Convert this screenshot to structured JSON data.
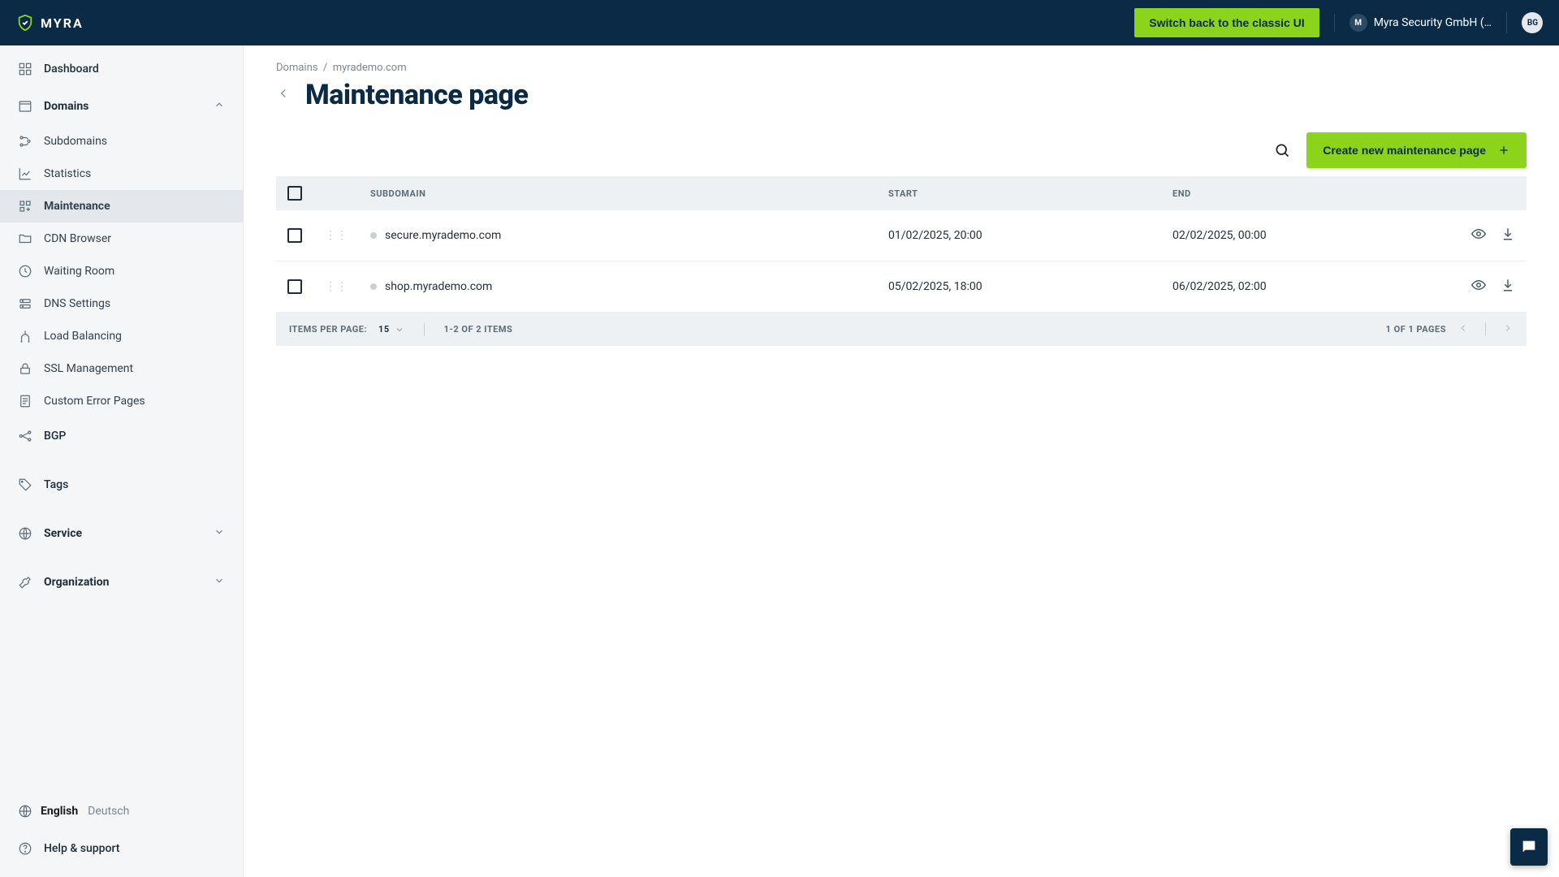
{
  "brand": "MYRA",
  "header": {
    "classic_ui_label": "Switch back to the classic UI",
    "org_name": "Myra Security GmbH (…",
    "org_initial": "M",
    "user_initials": "BG"
  },
  "sidebar": {
    "dashboard": "Dashboard",
    "domains": "Domains",
    "subitems": {
      "subdomains": "Subdomains",
      "statistics": "Statistics",
      "maintenance": "Maintenance",
      "cdn": "CDN Browser",
      "waiting": "Waiting Room",
      "dns": "DNS Settings",
      "lb": "Load Balancing",
      "ssl": "SSL Management",
      "errpages": "Custom Error Pages"
    },
    "bgp": "BGP",
    "tags": "Tags",
    "service": "Service",
    "organization": "Organization",
    "lang_en": "English",
    "lang_de": "Deutsch",
    "help": "Help & support"
  },
  "breadcrumbs": {
    "root": "Domains",
    "current": "myrademo.com"
  },
  "page_title": "Maintenance page",
  "actions": {
    "create_label": "Create new maintenance page"
  },
  "table": {
    "headers": {
      "subdomain": "SUBDOMAIN",
      "start": "START",
      "end": "END"
    },
    "rows": [
      {
        "subdomain": "secure.myrademo.com",
        "start": "01/02/2025, 20:00",
        "end": "02/02/2025, 00:00"
      },
      {
        "subdomain": "shop.myrademo.com",
        "start": "05/02/2025, 18:00",
        "end": "06/02/2025, 02:00"
      }
    ],
    "footer": {
      "items_per_page_label": "ITEMS PER PAGE:",
      "per_page_value": "15",
      "range_text": "1-2 OF 2 ITEMS",
      "page_text": "1 OF 1 PAGES"
    }
  }
}
